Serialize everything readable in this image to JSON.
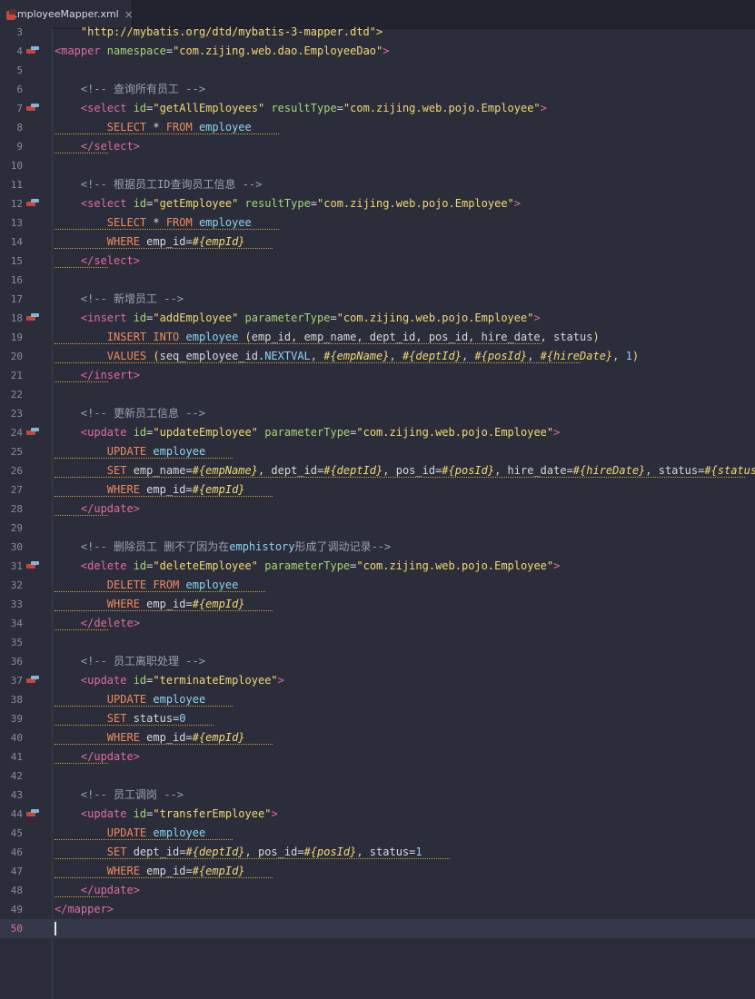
{
  "tab": {
    "filename": "EmployeeMapper.xml",
    "close": "×",
    "icon": "xml-file-icon"
  },
  "colors": {
    "background": "#2b2d3a",
    "tag": "#e06c9f",
    "attribute": "#a7d676",
    "string": "#f4d874",
    "comment": "#9aa0b4",
    "keyword": "#f08a5d",
    "table": "#8dd4f0"
  },
  "current_line": 50,
  "lines": [
    {
      "n": "3",
      "icon": false,
      "squiggle": 0,
      "tokens": [
        [
          "str",
          "    \"http://mybatis.org/dtd/mybatis-3-mapper.dtd\">"
        ]
      ]
    },
    {
      "n": "4",
      "icon": true,
      "squiggle": 0,
      "tokens": [
        [
          "tag",
          "<mapper "
        ],
        [
          "attr",
          "namespace"
        ],
        [
          "plain",
          "="
        ],
        [
          "str",
          "\"com.zijing.web.dao.EmployeeDao\""
        ],
        [
          "tag",
          ">"
        ]
      ]
    },
    {
      "n": "5",
      "icon": false,
      "squiggle": 0,
      "tokens": []
    },
    {
      "n": "6",
      "icon": false,
      "squiggle": 0,
      "tokens": [
        [
          "cmt",
          "    <!-- 查询所有员工 -->"
        ]
      ]
    },
    {
      "n": "7",
      "icon": true,
      "squiggle": 0,
      "tokens": [
        [
          "plain",
          "    "
        ],
        [
          "tag",
          "<select "
        ],
        [
          "attr",
          "id"
        ],
        [
          "plain",
          "="
        ],
        [
          "str",
          "\"getAllEmployees\" "
        ],
        [
          "attr",
          "resultType"
        ],
        [
          "plain",
          "="
        ],
        [
          "str",
          "\"com.zijing.web.pojo.Employee\""
        ],
        [
          "tag",
          ">"
        ]
      ]
    },
    {
      "n": "8",
      "icon": false,
      "squiggle": 30,
      "tokens": [
        [
          "plain",
          "        "
        ],
        [
          "kw",
          "SELECT "
        ],
        [
          "plain",
          "* "
        ],
        [
          "kw",
          "FROM "
        ],
        [
          "tbl",
          "employee"
        ]
      ]
    },
    {
      "n": "9",
      "icon": false,
      "squiggle": 4,
      "tokens": [
        [
          "plain",
          "    "
        ],
        [
          "tag",
          "</select>"
        ]
      ]
    },
    {
      "n": "10",
      "icon": false,
      "squiggle": 0,
      "tokens": []
    },
    {
      "n": "11",
      "icon": false,
      "squiggle": 0,
      "tokens": [
        [
          "cmt",
          "    <!-- 根据员工ID查询员工信息 -->"
        ]
      ]
    },
    {
      "n": "12",
      "icon": true,
      "squiggle": 0,
      "tokens": [
        [
          "plain",
          "    "
        ],
        [
          "tag",
          "<select "
        ],
        [
          "attr",
          "id"
        ],
        [
          "plain",
          "="
        ],
        [
          "str",
          "\"getEmployee\" "
        ],
        [
          "attr",
          "resultType"
        ],
        [
          "plain",
          "="
        ],
        [
          "str",
          "\"com.zijing.web.pojo.Employee\""
        ],
        [
          "tag",
          ">"
        ]
      ]
    },
    {
      "n": "13",
      "icon": false,
      "squiggle": 30,
      "tokens": [
        [
          "plain",
          "        "
        ],
        [
          "kw",
          "SELECT "
        ],
        [
          "plain",
          "* "
        ],
        [
          "kw",
          "FROM "
        ],
        [
          "tbl",
          "employee"
        ]
      ]
    },
    {
      "n": "14",
      "icon": false,
      "squiggle": 29,
      "tokens": [
        [
          "plain",
          "        "
        ],
        [
          "kw",
          "WHERE "
        ],
        [
          "plain",
          "emp_id="
        ],
        [
          "par",
          "#{empId}"
        ]
      ]
    },
    {
      "n": "15",
      "icon": false,
      "squiggle": 4,
      "tokens": [
        [
          "plain",
          "    "
        ],
        [
          "tag",
          "</select>"
        ]
      ]
    },
    {
      "n": "16",
      "icon": false,
      "squiggle": 0,
      "tokens": []
    },
    {
      "n": "17",
      "icon": false,
      "squiggle": 0,
      "tokens": [
        [
          "cmt",
          "    <!-- 新增员工 -->"
        ]
      ]
    },
    {
      "n": "18",
      "icon": true,
      "squiggle": 0,
      "tokens": [
        [
          "plain",
          "    "
        ],
        [
          "tag",
          "<insert "
        ],
        [
          "attr",
          "id"
        ],
        [
          "plain",
          "="
        ],
        [
          "str",
          "\"addEmployee\" "
        ],
        [
          "attr",
          "parameterType"
        ],
        [
          "plain",
          "="
        ],
        [
          "str",
          "\"com.zijing.web.pojo.Employee\""
        ],
        [
          "tag",
          ">"
        ]
      ]
    },
    {
      "n": "19",
      "icon": false,
      "squiggle": 70,
      "tokens": [
        [
          "plain",
          "        "
        ],
        [
          "kw",
          "INSERT INTO "
        ],
        [
          "tbl",
          "employee "
        ],
        [
          "str",
          "("
        ],
        [
          "plain",
          "emp_id, emp_name, dept_id, pos_id, hire_date, status"
        ],
        [
          "str",
          ")"
        ]
      ]
    },
    {
      "n": "20",
      "icon": false,
      "squiggle": 76,
      "tokens": [
        [
          "plain",
          "        "
        ],
        [
          "kw",
          "VALUES "
        ],
        [
          "str",
          "("
        ],
        [
          "plain",
          "seq_employee_id."
        ],
        [
          "tbl",
          "NEXTVAL"
        ],
        [
          "plain",
          ", "
        ],
        [
          "par",
          "#{empName}"
        ],
        [
          "plain",
          ", "
        ],
        [
          "par",
          "#{deptId}"
        ],
        [
          "plain",
          ", "
        ],
        [
          "par",
          "#{posId}"
        ],
        [
          "plain",
          ", "
        ],
        [
          "par",
          "#{hireDate}"
        ],
        [
          "plain",
          ", "
        ],
        [
          "tbl",
          "1"
        ],
        [
          "str",
          ")"
        ]
      ]
    },
    {
      "n": "21",
      "icon": false,
      "squiggle": 4,
      "tokens": [
        [
          "plain",
          "    "
        ],
        [
          "tag",
          "</insert>"
        ]
      ]
    },
    {
      "n": "22",
      "icon": false,
      "squiggle": 0,
      "tokens": []
    },
    {
      "n": "23",
      "icon": false,
      "squiggle": 0,
      "tokens": [
        [
          "cmt",
          "    <!-- 更新员工信息 -->"
        ]
      ]
    },
    {
      "n": "24",
      "icon": true,
      "squiggle": 0,
      "tokens": [
        [
          "plain",
          "    "
        ],
        [
          "tag",
          "<update "
        ],
        [
          "attr",
          "id"
        ],
        [
          "plain",
          "="
        ],
        [
          "str",
          "\"updateEmployee\" "
        ],
        [
          "attr",
          "parameterType"
        ],
        [
          "plain",
          "="
        ],
        [
          "str",
          "\"com.zijing.web.pojo.Employee\""
        ],
        [
          "tag",
          ">"
        ]
      ]
    },
    {
      "n": "25",
      "icon": false,
      "squiggle": 23,
      "tokens": [
        [
          "plain",
          "        "
        ],
        [
          "kw",
          "UPDATE "
        ],
        [
          "tbl",
          "employee"
        ]
      ]
    },
    {
      "n": "26",
      "icon": false,
      "squiggle": 108,
      "tokens": [
        [
          "plain",
          "        "
        ],
        [
          "kw",
          "SET "
        ],
        [
          "plain",
          "emp_name="
        ],
        [
          "par",
          "#{empName}"
        ],
        [
          "plain",
          ", dept_id="
        ],
        [
          "par",
          "#{deptId}"
        ],
        [
          "plain",
          ", pos_id="
        ],
        [
          "par",
          "#{posId}"
        ],
        [
          "plain",
          ", hire_date="
        ],
        [
          "par",
          "#{hireDate}"
        ],
        [
          "plain",
          ", status="
        ],
        [
          "par",
          "#{status}"
        ]
      ]
    },
    {
      "n": "27",
      "icon": false,
      "squiggle": 29,
      "tokens": [
        [
          "plain",
          "        "
        ],
        [
          "kw",
          "WHERE "
        ],
        [
          "plain",
          "emp_id="
        ],
        [
          "par",
          "#{empId}"
        ]
      ]
    },
    {
      "n": "28",
      "icon": false,
      "squiggle": 4,
      "tokens": [
        [
          "plain",
          "    "
        ],
        [
          "tag",
          "</update>"
        ]
      ]
    },
    {
      "n": "29",
      "icon": false,
      "squiggle": 0,
      "tokens": []
    },
    {
      "n": "30",
      "icon": false,
      "squiggle": 0,
      "tokens": [
        [
          "cmt",
          "    <!-- 删除员工 删不了因为在"
        ],
        [
          "tbl",
          "emphistory"
        ],
        [
          "cmt",
          "形成了调动记录-->"
        ]
      ]
    },
    {
      "n": "31",
      "icon": true,
      "squiggle": 0,
      "tokens": [
        [
          "plain",
          "    "
        ],
        [
          "tag",
          "<delete "
        ],
        [
          "attr",
          "id"
        ],
        [
          "plain",
          "="
        ],
        [
          "str",
          "\"deleteEmployee\" "
        ],
        [
          "attr",
          "parameterType"
        ],
        [
          "plain",
          "="
        ],
        [
          "str",
          "\"com.zijing.web.pojo.Employee\""
        ],
        [
          "tag",
          ">"
        ]
      ]
    },
    {
      "n": "32",
      "icon": false,
      "squiggle": 28,
      "tokens": [
        [
          "plain",
          "        "
        ],
        [
          "kw",
          "DELETE FROM "
        ],
        [
          "tbl",
          "employee"
        ]
      ]
    },
    {
      "n": "33",
      "icon": false,
      "squiggle": 29,
      "tokens": [
        [
          "plain",
          "        "
        ],
        [
          "kw",
          "WHERE "
        ],
        [
          "plain",
          "emp_id="
        ],
        [
          "par",
          "#{empId}"
        ]
      ]
    },
    {
      "n": "34",
      "icon": false,
      "squiggle": 4,
      "tokens": [
        [
          "plain",
          "    "
        ],
        [
          "tag",
          "</delete>"
        ]
      ]
    },
    {
      "n": "35",
      "icon": false,
      "squiggle": 0,
      "tokens": []
    },
    {
      "n": "36",
      "icon": false,
      "squiggle": 0,
      "tokens": [
        [
          "cmt",
          "    <!-- 员工离职处理 -->"
        ]
      ]
    },
    {
      "n": "37",
      "icon": true,
      "squiggle": 0,
      "tokens": [
        [
          "plain",
          "    "
        ],
        [
          "tag",
          "<update "
        ],
        [
          "attr",
          "id"
        ],
        [
          "plain",
          "="
        ],
        [
          "str",
          "\"terminateEmployee\""
        ],
        [
          "tag",
          ">"
        ]
      ]
    },
    {
      "n": "38",
      "icon": false,
      "squiggle": 23,
      "tokens": [
        [
          "plain",
          "        "
        ],
        [
          "kw",
          "UPDATE "
        ],
        [
          "tbl",
          "employee"
        ]
      ]
    },
    {
      "n": "39",
      "icon": false,
      "squiggle": 20,
      "tokens": [
        [
          "plain",
          "        "
        ],
        [
          "kw",
          "SET "
        ],
        [
          "plain",
          "status="
        ],
        [
          "tbl",
          "0"
        ]
      ]
    },
    {
      "n": "40",
      "icon": false,
      "squiggle": 29,
      "tokens": [
        [
          "plain",
          "        "
        ],
        [
          "kw",
          "WHERE "
        ],
        [
          "plain",
          "emp_id="
        ],
        [
          "par",
          "#{empId}"
        ]
      ]
    },
    {
      "n": "41",
      "icon": false,
      "squiggle": 4,
      "tokens": [
        [
          "plain",
          "    "
        ],
        [
          "tag",
          "</update>"
        ]
      ]
    },
    {
      "n": "42",
      "icon": false,
      "squiggle": 0,
      "tokens": []
    },
    {
      "n": "43",
      "icon": false,
      "squiggle": 0,
      "tokens": [
        [
          "cmt",
          "    <!-- 员工调岗 -->"
        ]
      ]
    },
    {
      "n": "44",
      "icon": true,
      "squiggle": 0,
      "tokens": [
        [
          "plain",
          "    "
        ],
        [
          "tag",
          "<update "
        ],
        [
          "attr",
          "id"
        ],
        [
          "plain",
          "="
        ],
        [
          "str",
          "\"transferEmployee\""
        ],
        [
          "tag",
          ">"
        ]
      ]
    },
    {
      "n": "45",
      "icon": false,
      "squiggle": 23,
      "tokens": [
        [
          "plain",
          "        "
        ],
        [
          "kw",
          "UPDATE "
        ],
        [
          "tbl",
          "employee"
        ]
      ]
    },
    {
      "n": "46",
      "icon": false,
      "squiggle": 56,
      "tokens": [
        [
          "plain",
          "        "
        ],
        [
          "kw",
          "SET "
        ],
        [
          "plain",
          "dept_id="
        ],
        [
          "par",
          "#{deptId}"
        ],
        [
          "plain",
          ", pos_id="
        ],
        [
          "par",
          "#{posId}"
        ],
        [
          "plain",
          ", status="
        ],
        [
          "tbl",
          "1"
        ]
      ]
    },
    {
      "n": "47",
      "icon": false,
      "squiggle": 29,
      "tokens": [
        [
          "plain",
          "        "
        ],
        [
          "kw",
          "WHERE "
        ],
        [
          "plain",
          "emp_id="
        ],
        [
          "par",
          "#{empId}"
        ]
      ]
    },
    {
      "n": "48",
      "icon": false,
      "squiggle": 4,
      "tokens": [
        [
          "plain",
          "    "
        ],
        [
          "tag",
          "</update>"
        ]
      ]
    },
    {
      "n": "49",
      "icon": false,
      "squiggle": 0,
      "tokens": [
        [
          "tag",
          "</mapper>"
        ]
      ]
    },
    {
      "n": "50",
      "icon": false,
      "squiggle": 0,
      "tokens": []
    }
  ]
}
